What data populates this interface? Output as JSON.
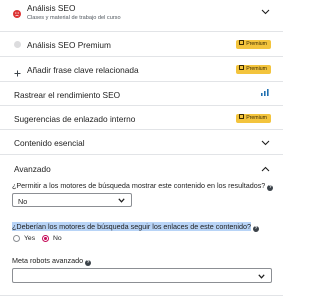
{
  "colors": {
    "badge_bg": "#f3c43d",
    "accent": "#c6105b",
    "highlight": "#b8d4f7"
  },
  "rows": [
    {
      "label": "Análisis SEO",
      "sublabel": "Clases y material de trabajo del curso",
      "icon": "sad-face-icon",
      "control": "chevron-down-icon"
    },
    {
      "label": "Análisis SEO Premium",
      "icon": "gray-dot-icon",
      "badge": "Premium"
    },
    {
      "label": "Añadir frase clave relacionada",
      "icon": "plus-icon",
      "badge": "Premium"
    },
    {
      "label": "Rastrear el rendimiento SEO",
      "control": "bar-chart-icon"
    },
    {
      "label": "Sugerencias de enlazado interno",
      "badge": "Premium"
    },
    {
      "label": "Contenido esencial",
      "control": "chevron-down-icon"
    }
  ],
  "advanced": {
    "title": "Avanzado",
    "allow_search_question": "¿Permitir a los motores de búsqueda mostrar este contenido en los resultados?",
    "allow_search_value": "No",
    "follow_links_question": "¿Deberían los motores de búsqueda seguir los enlaces de este contenido?",
    "follow_options": [
      "Yes",
      "No"
    ],
    "follow_selected": "No",
    "meta_robots_label": "Meta robots avanzado",
    "meta_robots_value": ""
  },
  "help_glyph": "?"
}
